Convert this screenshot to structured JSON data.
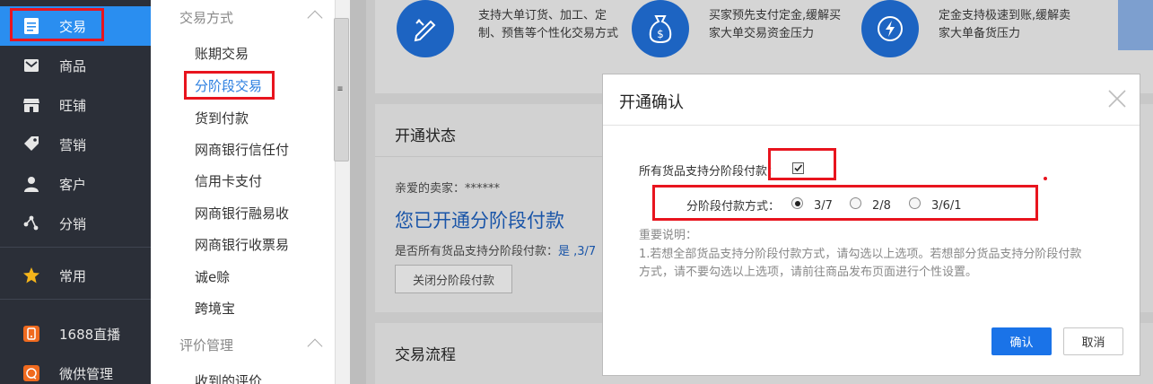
{
  "nav": {
    "items": [
      {
        "label": "交易",
        "icon": "document-icon"
      },
      {
        "label": "商品",
        "icon": "mail-icon"
      },
      {
        "label": "旺铺",
        "icon": "store-icon"
      },
      {
        "label": "营销",
        "icon": "tag-icon"
      },
      {
        "label": "客户",
        "icon": "user-icon"
      },
      {
        "label": "分销",
        "icon": "share-icon"
      },
      {
        "label": "常用",
        "icon": "star-icon"
      },
      {
        "label": "1688直播",
        "icon": "live-icon"
      },
      {
        "label": "微供管理",
        "icon": "chat-icon"
      }
    ],
    "active_color": "#2a8ef0"
  },
  "submenu": {
    "group1": "交易方式",
    "items": [
      "账期交易",
      "分阶段交易",
      "货到付款",
      "网商银行信任付",
      "信用卡支付",
      "网商银行融易收",
      "网商银行收票易",
      "诚e赊",
      "跨境宝"
    ],
    "group2": "评价管理",
    "group2_items": [
      "收到的评价"
    ]
  },
  "features": [
    {
      "text": "支持大单订货、加工、定制、预售等个性化交易方式",
      "icon": "pencil-ruler-icon"
    },
    {
      "text": "买家预先支付定金,缓解买家大单交易资金压力",
      "icon": "money-bag-icon"
    },
    {
      "text": "定金支持极速到账,缓解卖家大单备货压力",
      "icon": "lightning-icon"
    }
  ],
  "status_panel": {
    "title": "开通状态",
    "greeting": "亲爱的卖家：******",
    "headline": "您已开通分阶段付款",
    "support_prefix": "是否所有货品支持分阶段付款：",
    "support_value": "是 ,3/7",
    "close_button": "关闭分阶段付款"
  },
  "flow_panel": {
    "title": "交易流程"
  },
  "modal": {
    "title": "开通确认",
    "all_goods_label": "所有货品支持分阶段付款：",
    "all_goods_checked": true,
    "mode_label": "分阶段付款方式：",
    "options": [
      "3/7",
      "2/8",
      "3/6/1"
    ],
    "selected": "3/7",
    "note_title": "重要说明：",
    "note_line1": "1.若想全部货品支持分阶段付款方式，请勾选以上选项。若想部分货品支持分阶段付款",
    "note_line2": "方式，请不要勾选以上选项，请前往商品发布页面进行个性设置。",
    "confirm": "确认",
    "cancel": "取消"
  },
  "colors": {
    "highlight": "#e8141e",
    "primary": "#1a73e8",
    "nav_bg": "#2b2f38"
  }
}
